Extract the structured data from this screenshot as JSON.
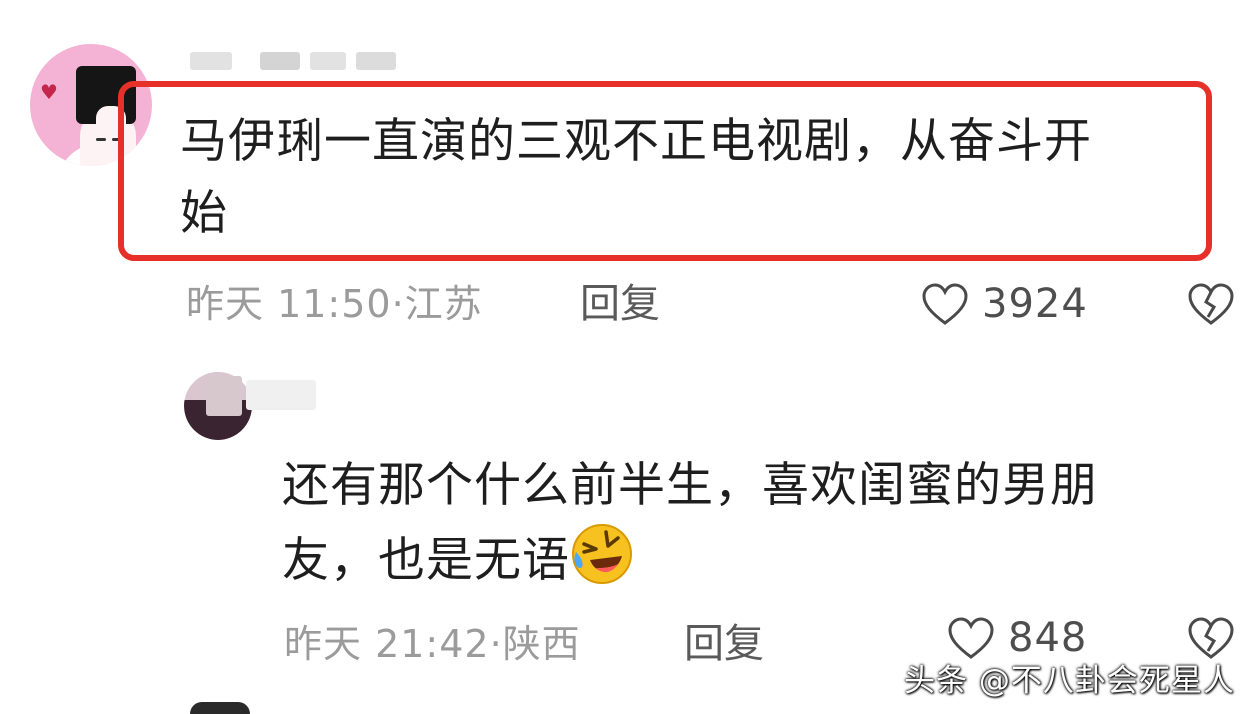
{
  "comments": [
    {
      "text_line1": "马伊琍一直演的三观不正电视剧，从奋斗开",
      "text_line2": "始",
      "time": "昨天 11:50·江苏",
      "reply_label": "回复",
      "likes": "3924",
      "highlight_color": "#e8302a"
    },
    {
      "text_line1": "还有那个什么前半生，喜欢闺蜜的男朋",
      "text_line2": "友，也是无语",
      "emoji": "rofl-emoji",
      "time": "昨天 21:42·陕西",
      "reply_label": "回复",
      "likes": "848"
    }
  ],
  "icons": {
    "like": "heart-outline-icon",
    "dislike": "broken-heart-icon"
  },
  "watermark": "头条 @不八卦会死星人"
}
